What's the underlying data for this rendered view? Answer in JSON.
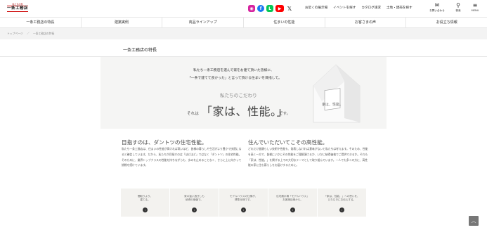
{
  "header": {
    "logo_tag": "私たちの家",
    "logo_text": "一条工務店",
    "social": [
      "◉",
      "f",
      "L",
      "▶",
      "𝕏"
    ],
    "links": [
      "お近くの展示場",
      "イベントを探す",
      "カタログ請求",
      "土地・建売を探す"
    ],
    "icons": [
      {
        "glyph": "✉",
        "label": "お問い合わせ"
      },
      {
        "glyph": "⚲",
        "label": "検索"
      },
      {
        "glyph": "≡",
        "label": "MENU"
      }
    ]
  },
  "nav": [
    "一条工務店の特長",
    "建築実例",
    "商品ラインアップ",
    "住まいの性能",
    "お客さまの声",
    "お役立ち情報"
  ],
  "breadcrumb": [
    "トップページ",
    "／",
    "一条工務店の特長"
  ],
  "page_title": "一条工務店の特長",
  "hero": {
    "intro_line1": "私たち一条工務店を選んで家をお建て頂いた皆様に、",
    "intro_line2": "「一条で建てて良かった」と言って頂ける住まいを目指して。",
    "kodawari": "私たちのこだわり",
    "sorewa": "それは",
    "catch": "「家は、性能。」",
    "desu": "です。",
    "house_sign": "家は、性能。"
  },
  "columns": [
    {
      "heading": "目指すのは、ダントツの住宅性能。",
      "body": "私たち一条工務店は、住まいの性能が高ければ高いほど、皆様の暮らしや生活がより豊かで快適になると確信しています。だから、私たちが目指すのは「ほどほど」ではなく「ダントツ」の住宅性能。そのために、業界トップクラスの性能を持ちながらも、歩みを止めることなく、さらに上に向かって挑戦を続けています。"
    },
    {
      "heading": "住んでいただいてこその高性能。",
      "body": "どれだけ書類らしい技術や性能も、発表しなければ意味がないと私たちは考えます。そのため、性能を高く一方で、皆様にいかにその性能をご理解頂けるか、いかに納得価格でご提供できるか。それも「家は、性能。」を掲げる上での大切なテーマとして取り組んでいます。一人でも多くの方に、高性能の家に住む暮らしをお届けするために。"
    }
  ],
  "cards": [
    "間取りより、\n建てる。",
    "家の温い過ぎしも\n納得の価値で。",
    "モデルハウスの仕様が、\n標準仕様です。",
    "住宅展示場「モデルハウス」\nお客様目線から。",
    "「家は、性能。」への思いを、\nひたむきにお伝えする。"
  ],
  "card_arrow": "›",
  "pagetop": "︿"
}
